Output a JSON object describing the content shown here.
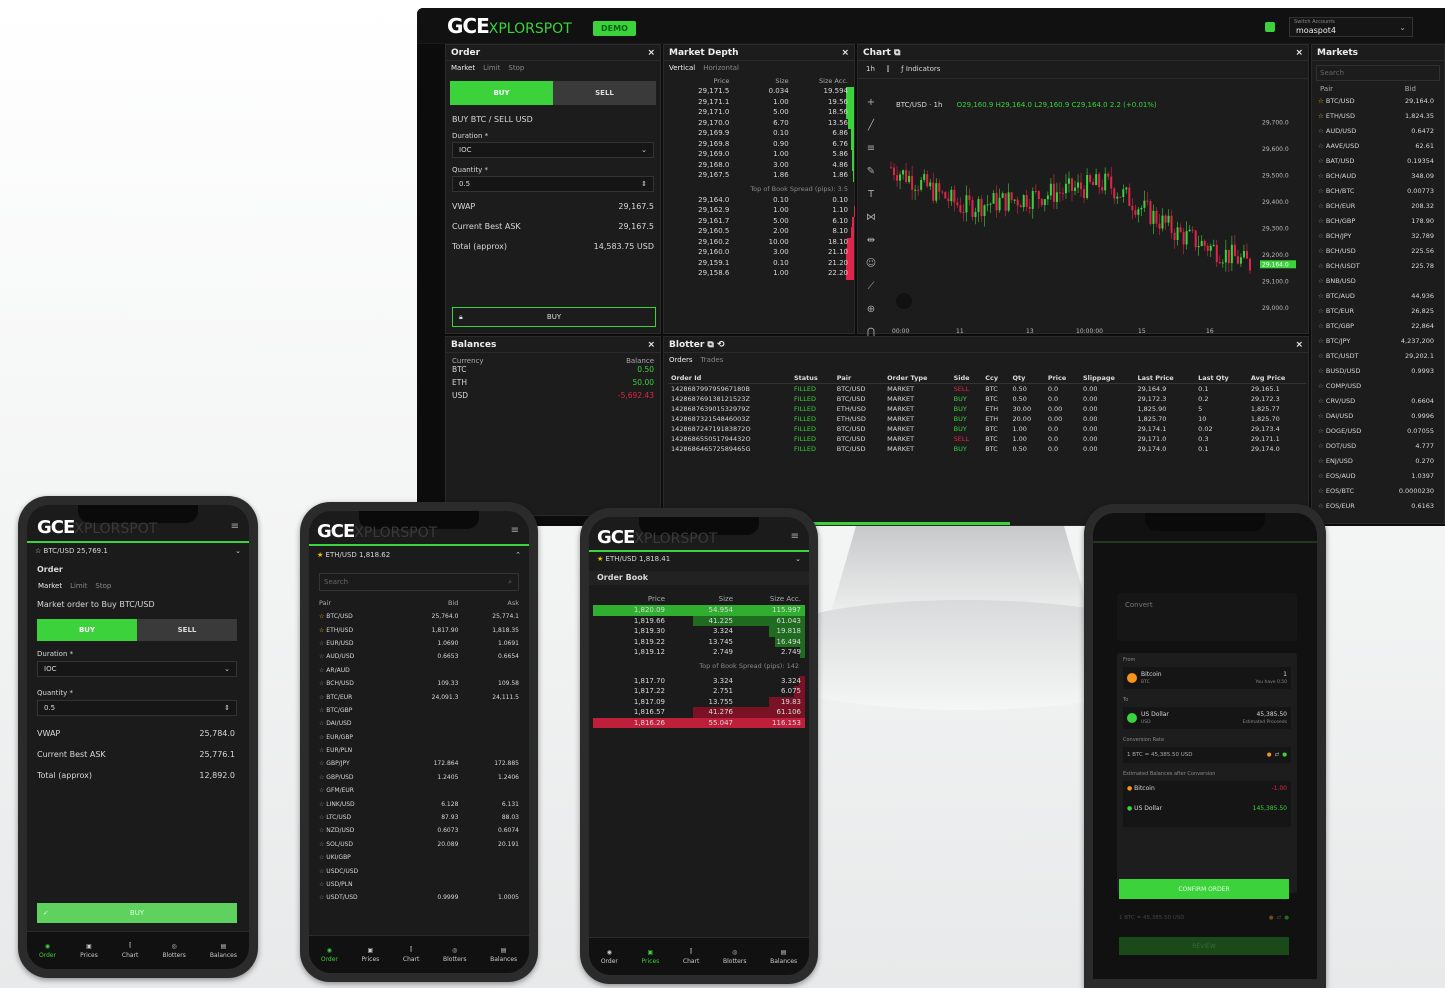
{
  "brand": {
    "logo_main": "GCE",
    "logo_sub": "XPLORSPOT",
    "badge": "DEMO"
  },
  "account": {
    "switch_label": "Switch Accounts",
    "name": "moaspot4"
  },
  "order": {
    "title": "Order",
    "tabs": [
      "Market",
      "Limit",
      "Stop"
    ],
    "buy": "BUY",
    "sell": "SELL",
    "pair_text": "BUY BTC / SELL USD",
    "duration_label": "Duration *",
    "duration_value": "IOC",
    "quantity_label": "Quantity *",
    "quantity_value": "0.5",
    "vwap_label": "VWAP",
    "vwap_value": "29,167.5",
    "ask_label": "Current Best ASK",
    "ask_value": "29,167.5",
    "total_label": "Total (approx)",
    "total_value": "14,583.75 USD",
    "submit": "BUY"
  },
  "depth": {
    "title": "Market Depth",
    "tabs": [
      "Vertical",
      "Horizontal"
    ],
    "headers": [
      "Price",
      "Size",
      "Size Acc."
    ],
    "asks": [
      [
        "29,171.5",
        "0.034",
        "19.594"
      ],
      [
        "29,171.1",
        "1.00",
        "19.56"
      ],
      [
        "29,171.0",
        "5.00",
        "18.56"
      ],
      [
        "29,170.0",
        "6.70",
        "13.56"
      ],
      [
        "29,169.9",
        "0.10",
        "6.86"
      ],
      [
        "29,169.8",
        "0.90",
        "6.76"
      ],
      [
        "29,169.0",
        "1.00",
        "5.86"
      ],
      [
        "29,168.0",
        "3.00",
        "4.86"
      ],
      [
        "29,167.5",
        "1.86",
        "1.86"
      ]
    ],
    "spread": "Top of Book Spread (pips): 3.5",
    "bids": [
      [
        "29,164.0",
        "0.10",
        "0.10"
      ],
      [
        "29,162.9",
        "1.00",
        "1.10"
      ],
      [
        "29,161.7",
        "5.00",
        "6.10"
      ],
      [
        "29,160.5",
        "2.00",
        "8.10"
      ],
      [
        "29,160.2",
        "10.00",
        "18.10"
      ],
      [
        "29,160.0",
        "3.00",
        "21.10"
      ],
      [
        "29,159.1",
        "0.10",
        "21.20"
      ],
      [
        "29,158.6",
        "1.00",
        "22.20"
      ]
    ]
  },
  "chart": {
    "title": "Chart",
    "interval": "1h",
    "indicators": "Indicators",
    "symbol": "BTC/USD · 1h",
    "ohlc": "O29,160.9 H29,164.0 L29,160.9 C29,164.0 2.2 (+0.01%)",
    "yticks": [
      "29,700.0",
      "29,600.0",
      "29,500.0",
      "29,400.0",
      "29,300.0",
      "29,200.0",
      "29,100.0",
      "29,000.0"
    ],
    "last_price": "29,164.0",
    "xticks": [
      "00:00",
      "11",
      "13",
      "10:00:00",
      "15",
      "16"
    ]
  },
  "chart_data": {
    "type": "line",
    "title": "BTC/USD · 1h",
    "xlabel": "",
    "ylabel": "",
    "x": [
      "00:00",
      "11",
      "13",
      "10:00:00",
      "15",
      "16"
    ],
    "series": [
      {
        "name": "BTC/USD",
        "values": [
          29530,
          29380,
          29420,
          29470,
          29280,
          29164
        ]
      }
    ],
    "ylim": [
      28950,
      29750
    ]
  },
  "markets": {
    "title": "Markets",
    "search": "Search",
    "headers": [
      "Pair",
      "Bid"
    ],
    "rows": [
      [
        "BTC/USD",
        "29,164.0"
      ],
      [
        "ETH/USD",
        "1,824.35"
      ],
      [
        "AUD/USD",
        "0.6472"
      ],
      [
        "AAVE/USD",
        "62.61"
      ],
      [
        "BAT/USD",
        "0.19354"
      ],
      [
        "BCH/AUD",
        "348.09"
      ],
      [
        "BCH/BTC",
        "0.00773"
      ],
      [
        "BCH/EUR",
        "208.32"
      ],
      [
        "BCH/GBP",
        "178.90"
      ],
      [
        "BCH/JPY",
        "32,789"
      ],
      [
        "BCH/USD",
        "225.56"
      ],
      [
        "BCH/USDT",
        "225.78"
      ],
      [
        "BNB/USD",
        ""
      ],
      [
        "BTC/AUD",
        "44,936"
      ],
      [
        "BTC/EUR",
        "26,825"
      ],
      [
        "BTC/GBP",
        "22,864"
      ],
      [
        "BTC/JPY",
        "4,237,200"
      ],
      [
        "BTC/USDT",
        "29,202.1"
      ],
      [
        "BUSD/USD",
        "0.9993"
      ],
      [
        "COMP/USD",
        ""
      ],
      [
        "CRV/USD",
        "0.6604"
      ],
      [
        "DAI/USD",
        "0.9996"
      ],
      [
        "DOGE/USD",
        "0.07055"
      ],
      [
        "DOT/USD",
        "4.777"
      ],
      [
        "ENJ/USD",
        "0.270"
      ],
      [
        "EOS/AUD",
        "1.0397"
      ],
      [
        "EOS/BTC",
        "0.0000230"
      ],
      [
        "EOS/EUR",
        "0.6163"
      ]
    ]
  },
  "balances": {
    "title": "Balances",
    "headers": [
      "Currency",
      "Balance"
    ],
    "rows": [
      [
        "BTC",
        "0.50"
      ],
      [
        "ETH",
        "50.00"
      ],
      [
        "USD",
        "-5,692.43"
      ]
    ]
  },
  "blotter": {
    "title": "Blotter",
    "tabs": [
      "Orders",
      "Trades"
    ],
    "headers": [
      "Order Id",
      "Status",
      "Pair",
      "Order Type",
      "Side",
      "Ccy",
      "Qty",
      "Price",
      "Slippage",
      "Last Price",
      "Last Qty",
      "Avg Price"
    ],
    "rows": [
      [
        "142868799795967180B",
        "FILLED",
        "BTC/USD",
        "MARKET",
        "SELL",
        "BTC",
        "0.50",
        "0.0",
        "0.00",
        "29,164.9",
        "0.1",
        "29,165.1"
      ],
      [
        "142868769138121523Z",
        "FILLED",
        "BTC/USD",
        "MARKET",
        "BUY",
        "BTC",
        "0.50",
        "0.0",
        "0.00",
        "29,172.3",
        "0.2",
        "29,172.3"
      ],
      [
        "142868763901532979Z",
        "FILLED",
        "ETH/USD",
        "MARKET",
        "BUY",
        "ETH",
        "30.00",
        "0.00",
        "0.00",
        "1,825.90",
        "5",
        "1,825.77"
      ],
      [
        "142868732154846003Z",
        "FILLED",
        "ETH/USD",
        "MARKET",
        "BUY",
        "ETH",
        "20.00",
        "0.00",
        "0.00",
        "1,825.70",
        "10",
        "1,825.70"
      ],
      [
        "142868724719183872O",
        "FILLED",
        "BTC/USD",
        "MARKET",
        "BUY",
        "BTC",
        "1.00",
        "0.0",
        "0.00",
        "29,174.1",
        "0.02",
        "29,173.4"
      ],
      [
        "142868655051794432O",
        "FILLED",
        "BTC/USD",
        "MARKET",
        "SELL",
        "BTC",
        "1.00",
        "0.0",
        "0.00",
        "29,171.0",
        "0.3",
        "29,171.1"
      ],
      [
        "142868646572589465G",
        "FILLED",
        "BTC/USD",
        "MARKET",
        "BUY",
        "BTC",
        "0.50",
        "0.0",
        "0.00",
        "29,174.0",
        "0.1",
        "29,174.0"
      ]
    ]
  },
  "phone1": {
    "pair": "BTC/USD",
    "price": "25,769.1",
    "order": "Order",
    "tabs": [
      "Market",
      "Limit",
      "Stop"
    ],
    "desc": "Market order to Buy BTC/USD",
    "buy": "BUY",
    "sell": "SELL",
    "duration_label": "Duration *",
    "duration_value": "IOC",
    "quantity_label": "Quantity *",
    "quantity_value": "0.5",
    "vwap_label": "VWAP",
    "vwap_value": "25,784.0",
    "ask_label": "Current Best ASK",
    "ask_value": "25,776.1",
    "total_label": "Total (approx)",
    "total_value": "12,892.0",
    "submit": "BUY"
  },
  "phone2": {
    "pair": "ETH/USD",
    "price": "1,818.62",
    "search": "Search",
    "headers": [
      "Pair",
      "Bid",
      "Ask"
    ],
    "rows": [
      [
        "BTC/USD",
        "25,764.0",
        "25,774.1"
      ],
      [
        "ETH/USD",
        "1,817.90",
        "1,818.35"
      ],
      [
        "EUR/USD",
        "1.0690",
        "1.0691"
      ],
      [
        "AUD/USD",
        "0.6653",
        "0.6654"
      ],
      [
        "AR/AUD",
        "",
        ""
      ],
      [
        "BCH/USD",
        "109.33",
        "109.58"
      ],
      [
        "BTC/EUR",
        "24,091.3",
        "24,111.5"
      ],
      [
        "BTC/GBP",
        "",
        ""
      ],
      [
        "DAI/USD",
        "",
        ""
      ],
      [
        "EUR/GBP",
        "",
        ""
      ],
      [
        "EUR/PLN",
        "",
        ""
      ],
      [
        "GBP/JPY",
        "172.864",
        "172.885"
      ],
      [
        "GBP/USD",
        "1.2405",
        "1.2406"
      ],
      [
        "GFM/EUR",
        "",
        ""
      ],
      [
        "LINK/USD",
        "6.128",
        "6.131"
      ],
      [
        "LTC/USD",
        "87.93",
        "88.03"
      ],
      [
        "NZD/USD",
        "0.6073",
        "0.6074"
      ],
      [
        "SOL/USD",
        "20.089",
        "20.191"
      ],
      [
        "UKI/GBP",
        "",
        ""
      ],
      [
        "USDC/USD",
        "",
        ""
      ],
      [
        "USD/PLN",
        "",
        ""
      ],
      [
        "USDT/USD",
        "0.9999",
        "1.0005"
      ]
    ]
  },
  "phone3": {
    "pair": "ETH/USD",
    "price": "1,818.41",
    "title": "Order Book",
    "headers": [
      "Price",
      "Size",
      "Size Acc."
    ],
    "asks": [
      [
        "1,820.09",
        "54.954",
        "115.997"
      ],
      [
        "1,819.66",
        "41.225",
        "61.043"
      ],
      [
        "1,819.30",
        "3.324",
        "19.818"
      ],
      [
        "1,819.22",
        "13.745",
        "16.494"
      ],
      [
        "1,819.12",
        "2.749",
        "2.749"
      ]
    ],
    "spread": "Top of Book Spread (pips): 142",
    "bids": [
      [
        "1,817.70",
        "3.324",
        "3.324"
      ],
      [
        "1,817.22",
        "2.751",
        "6.075"
      ],
      [
        "1,817.09",
        "13.755",
        "19.83"
      ],
      [
        "1,816.57",
        "41.276",
        "61.106"
      ],
      [
        "1,816.26",
        "55.047",
        "116.153"
      ]
    ]
  },
  "phone4": {
    "title": "Convert",
    "from_label": "From",
    "from_coin": "Bitcoin",
    "from_code": "BTC",
    "from_amount": "1",
    "from_note": "You have 0.50",
    "to_label": "To",
    "to_coin": "US Dollar",
    "to_code": "USD",
    "to_amount": "45,385.50",
    "to_note": "Estimated Proceeds",
    "rate_label": "Conversion Rate",
    "rate": "1 BTC = 45,385.50 USD",
    "est_label": "Estimated Balances after Conversion",
    "est_btc": "-1.00",
    "est_usd": "145,385.50",
    "confirm": "CONFIRM ORDER",
    "review": "REVIEW"
  },
  "nav": [
    "Order",
    "Prices",
    "Chart",
    "Blotters",
    "Balances"
  ]
}
